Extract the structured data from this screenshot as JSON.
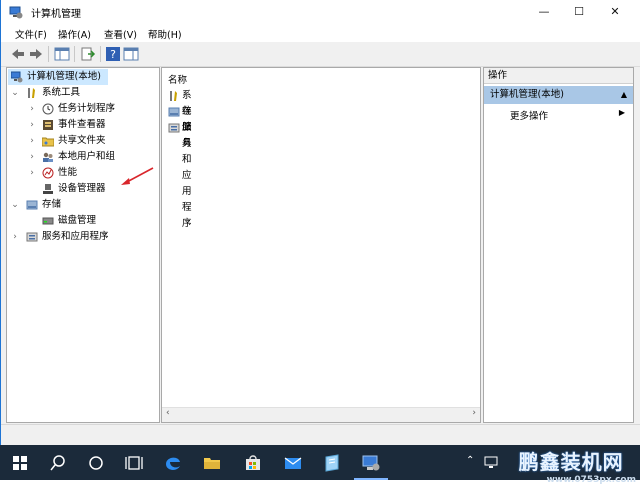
{
  "window": {
    "title": "计算机管理"
  },
  "menu": [
    "文件(F)",
    "操作(A)",
    "查看(V)",
    "帮助(H)"
  ],
  "tree": {
    "root": "计算机管理(本地)",
    "system_tools": "系统工具",
    "task_scheduler": "任务计划程序",
    "event_viewer": "事件查看器",
    "shared_folders": "共享文件夹",
    "local_users": "本地用户和组",
    "performance": "性能",
    "device_manager": "设备管理器",
    "storage": "存储",
    "disk_management": "磁盘管理",
    "services_apps": "服务和应用程序"
  },
  "list": {
    "header": "名称",
    "items": [
      "系统工具",
      "存储",
      "服务和应用程序"
    ]
  },
  "actions": {
    "header": "操作",
    "section": "计算机管理(本地)",
    "more": "更多操作"
  },
  "watermark": {
    "name": "鹏鑫装机网",
    "url": "www.0753px.com"
  }
}
